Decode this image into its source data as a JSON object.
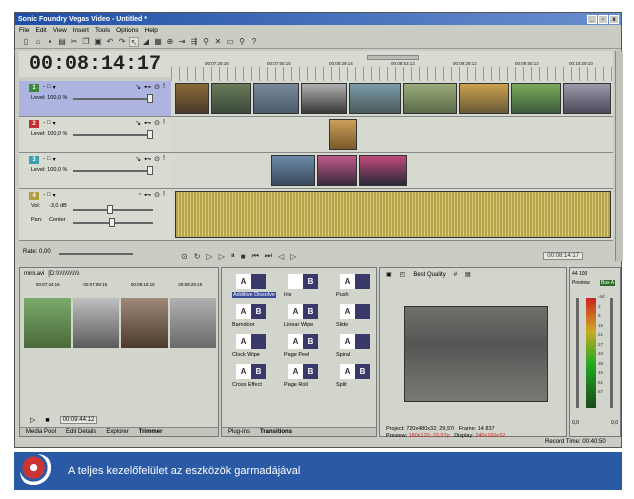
{
  "window": {
    "title": "Sonic Foundry Vegas Video - Untitled *",
    "controls": [
      "_",
      "▫",
      "x"
    ]
  },
  "menu": [
    "File",
    "Edit",
    "View",
    "Insert",
    "Tools",
    "Options",
    "Help"
  ],
  "timecode": "00:08:14:17",
  "ruler_labels": [
    "00:07:29:16",
    "00:07:55:15",
    "00:08:29:14",
    "00:08:53:13",
    "00:09:29:12",
    "00:09:55:12",
    "00:10:29:10"
  ],
  "tracks": [
    {
      "num": "1",
      "color": "#3a8a3a",
      "level": "Level: 100,0 %"
    },
    {
      "num": "2",
      "color": "#c03030",
      "level": "Level: 100,0 %"
    },
    {
      "num": "3",
      "color": "#3aa0b0",
      "level": "Level: 100,0 %"
    }
  ],
  "audio_track": {
    "num": "4",
    "vol_label": "Vol:",
    "vol": "-3,0 dB",
    "pan_label": "Pan:",
    "pan": "Center"
  },
  "rate": "Rate: 0,00",
  "transport_time": "00:08:14:17",
  "trimmer": {
    "file": "mini.avi",
    "path": "[D:\\\\\\\\\\\\\\\\\\\\\\\\\\\\",
    "ruler": [
      "00:07:44:16",
      "00:07:59:15",
      "00:08:15:15",
      "00:08:29:15"
    ],
    "time": "00:09:44:12",
    "tabs": [
      "Media Pool",
      "Edit Details",
      "Explorer",
      "Trimmer"
    ]
  },
  "transitions": {
    "items": [
      {
        "name": "Additive Dissolve",
        "a": "A",
        "b": "",
        "selected": true
      },
      {
        "name": "Iris",
        "a": "",
        "b": "B",
        "selected": false
      },
      {
        "name": "Push",
        "a": "A",
        "b": "",
        "selected": false
      },
      {
        "name": "Barndoor",
        "a": "A",
        "b": "B",
        "selected": false
      },
      {
        "name": "Linear Wipe",
        "a": "A",
        "b": "B",
        "selected": false
      },
      {
        "name": "Slide",
        "a": "A",
        "b": "",
        "selected": false
      },
      {
        "name": "Clock Wipe",
        "a": "A",
        "b": "",
        "selected": false
      },
      {
        "name": "Page Peel",
        "a": "A",
        "b": "B",
        "selected": false
      },
      {
        "name": "Spiral",
        "a": "A",
        "b": "",
        "selected": false
      },
      {
        "name": "Cross Effect",
        "a": "A",
        "b": "B",
        "selected": false
      },
      {
        "name": "Page Roll",
        "a": "A",
        "b": "B",
        "selected": false
      },
      {
        "name": "Split",
        "a": "A",
        "b": "B",
        "selected": false
      }
    ],
    "tabs": [
      "Plug-Ins",
      "Transitions"
    ]
  },
  "preview": {
    "quality": "Best Quality",
    "project_label": "Project:",
    "project": "720x480x32; 29,97i",
    "frame_label": "Frame:",
    "frame": "14 837",
    "preview_label": "Preview:",
    "preview": "180x120; 29,97p",
    "display_label": "Display:",
    "display": "240x160x32"
  },
  "mixer": {
    "title": "Preview",
    "bus": "Bus A",
    "rate": "44 100",
    "db": [
      "-Inf.",
      "-Inf.",
      "3",
      "9",
      "15",
      "21",
      "27",
      "33",
      "39",
      "45",
      "51",
      "57"
    ],
    "bottom": [
      "0,0",
      "0,0"
    ]
  },
  "record_time": "Record Time: 00:40:50",
  "caption": "A teljes kezelőfelület az eszközök garmadájával"
}
